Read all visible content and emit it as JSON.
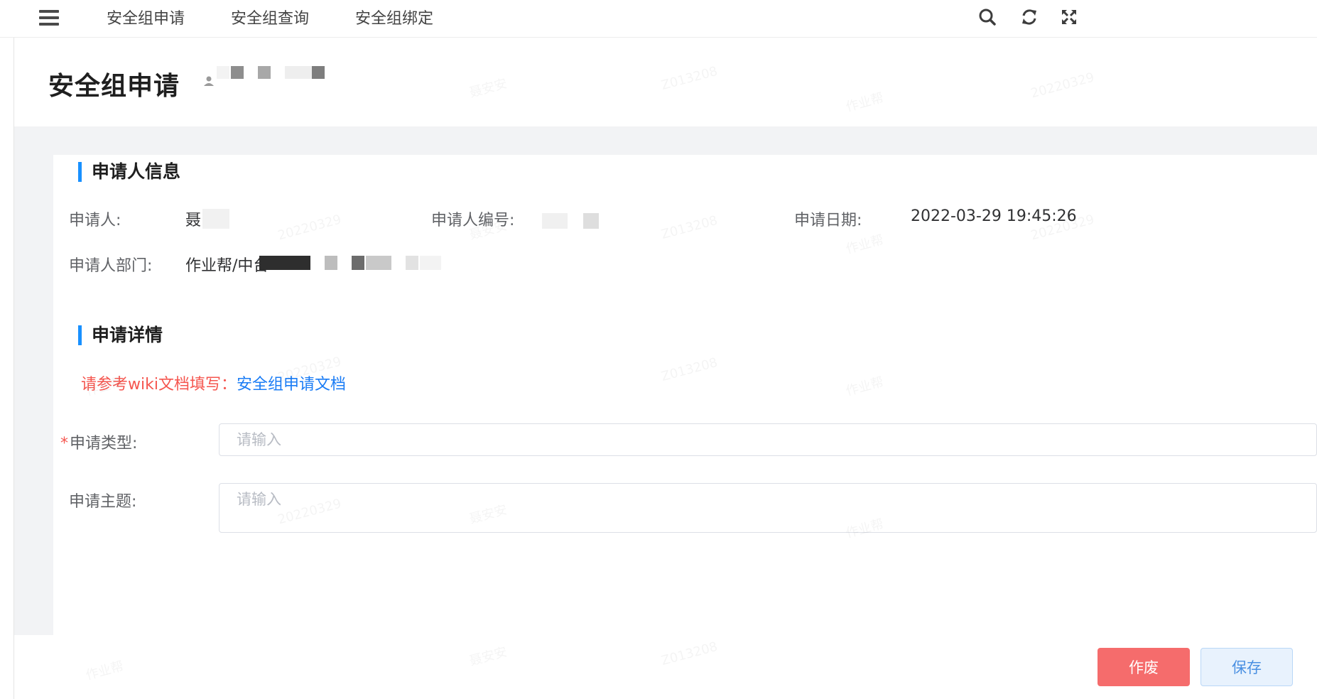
{
  "nav": {
    "links": [
      "安全组申请",
      "安全组查询",
      "安全组绑定"
    ],
    "icons": [
      "menu-icon",
      "search-icon",
      "refresh-icon",
      "fullscreen-icon"
    ]
  },
  "header": {
    "title": "安全组申请"
  },
  "applicant_section": {
    "title": "申请人信息",
    "applicant_label": "申请人:",
    "applicant_value": "聂",
    "id_label": "申请人编号:",
    "date_label": "申请日期:",
    "date_value": "2022-03-29 19:45:26",
    "dept_label": "申请人部门:",
    "dept_value": "作业帮/中台"
  },
  "detail_section": {
    "title": "申请详情",
    "hint_text": "请参考wiki文档填写：",
    "hint_link": "安全组申请文档",
    "type_label": "申请类型:",
    "type_required_mark": "*",
    "type_placeholder": "请输入",
    "subject_label": "申请主题:",
    "subject_placeholder": "请输入"
  },
  "footer": {
    "void_label": "作废",
    "save_label": "保存"
  },
  "colors": {
    "accent": "#1890ff",
    "danger": "#f56c6c",
    "link": "#1a7cf5",
    "hint_red": "#f5564f"
  },
  "watermark": {
    "items": [
      "作业帮",
      "20220329",
      "聂安安",
      "Z013208"
    ]
  }
}
